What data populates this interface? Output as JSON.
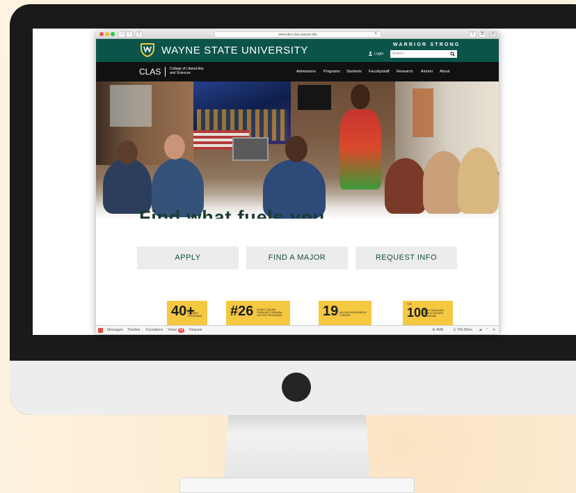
{
  "browser": {
    "url": "www-dev.clas.wayne.edu",
    "dots": [
      "#f45952",
      "#f7bd2c",
      "#29c941"
    ]
  },
  "header": {
    "university": "WAYNE STATE UNIVERSITY",
    "tagline": "WARRIOR STRONG",
    "login": "Login",
    "search_placeholder": "Search...",
    "brand_color": "#0c5449"
  },
  "subheader": {
    "clas": "CLAS",
    "college_line1": "College of Liberal Arts",
    "college_line2": "and Sciences",
    "nav": [
      "Admissions",
      "Programs",
      "Students",
      "Faculty/staff",
      "Research",
      "Alumni",
      "About"
    ]
  },
  "hero": {
    "title": "Find what fuels you."
  },
  "ctas": [
    "APPLY",
    "FIND A MAJOR",
    "REQUEST INFO"
  ],
  "stats": [
    {
      "big": "40+",
      "small": "DEGREE PROGRAMS"
    },
    {
      "big": "#26",
      "small": "IN BEST ONLINE GRADUATE CRIMINAL JUSTICE PROGRAMS"
    },
    {
      "big": "19",
      "small": "MILLION IN RESEARCH FUNDING"
    },
    {
      "big": "100",
      "prefix": "TOP",
      "small": "BEST GRADUATE PUBLIC AFFAIRS PROGRAM"
    }
  ],
  "debugbar": {
    "tabs": [
      "Messages",
      "Timeline",
      "Exceptions",
      "Views",
      "Request"
    ],
    "views_count": "18",
    "memory": "4MB",
    "time": "766.05ms"
  }
}
